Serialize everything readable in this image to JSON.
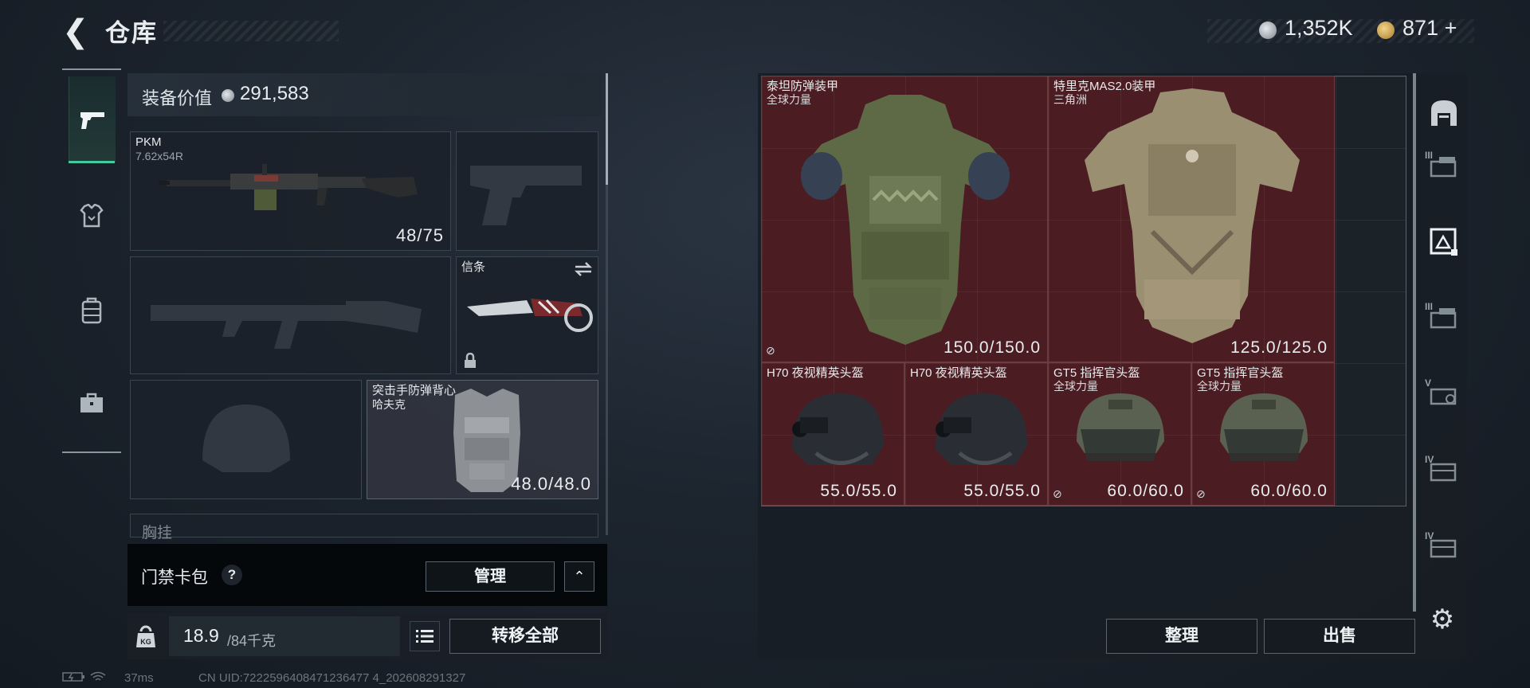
{
  "header": {
    "back_glyph": "❮",
    "title": "仓库",
    "currency1_value": "1,352K",
    "currency2_value": "871",
    "currency2_plus": "+"
  },
  "left_tabs": [
    {
      "name": "weapons",
      "icon": "pistol-icon",
      "selected": true
    },
    {
      "name": "armor",
      "icon": "armor-icon"
    },
    {
      "name": "backpack",
      "icon": "backpack-icon"
    },
    {
      "name": "briefcase",
      "icon": "briefcase-icon"
    }
  ],
  "loadout": {
    "value_label": "装备价值",
    "value": "291,583",
    "primary": {
      "name": "PKM",
      "caliber": "7.62x54R",
      "ammo": "48/75"
    },
    "melee": {
      "name": "信条"
    },
    "vest": {
      "name": "突击手防弹背心",
      "variant": "哈夫克",
      "durability": "48.0/48.0"
    },
    "chest_label": "胸挂"
  },
  "access_card": {
    "label": "门禁卡包",
    "help": "?",
    "manage_label": "管理",
    "collapse_glyph": "⌃"
  },
  "weight": {
    "current": "18.9",
    "max": "/84千克",
    "icon_label": "KG",
    "transfer_label": "转移全部"
  },
  "status_bar": {
    "ping": "37ms",
    "uid": "CN UID:7222596408471236477 4_202608291327"
  },
  "storage": {
    "items": [
      {
        "name": "泰坦防弹装甲",
        "region": "全球力量",
        "durability": "150.0/150.0"
      },
      {
        "name": "特里克MAS2.0装甲",
        "region": "三角洲",
        "durability": "125.0/125.0"
      },
      {
        "name": "H70 夜视精英头盔",
        "region": "",
        "durability": "55.0/55.0"
      },
      {
        "name": "H70 夜视精英头盔",
        "region": "",
        "durability": "55.0/55.0"
      },
      {
        "name": "GT5 指挥官头盔",
        "region": "全球力量",
        "durability": "60.0/60.0"
      },
      {
        "name": "GT5 指挥官头盔",
        "region": "全球力量",
        "durability": "60.0/60.0"
      }
    ],
    "sort_label": "整理",
    "sell_label": "出售"
  },
  "right_tabs": [
    {
      "icon": "stash-icon",
      "level": ""
    },
    {
      "icon": "container-icon",
      "level": "III"
    },
    {
      "icon": "armor-storage-icon",
      "level": "",
      "selected": true
    },
    {
      "icon": "container-icon",
      "level": "III"
    },
    {
      "icon": "container-icon",
      "level": "V"
    },
    {
      "icon": "container-icon",
      "level": "IV"
    },
    {
      "icon": "container-icon",
      "level": "IV"
    }
  ],
  "colors": {
    "accent": "#43c99d",
    "item_bg": "#4b1d22",
    "background": "#1c242e"
  }
}
